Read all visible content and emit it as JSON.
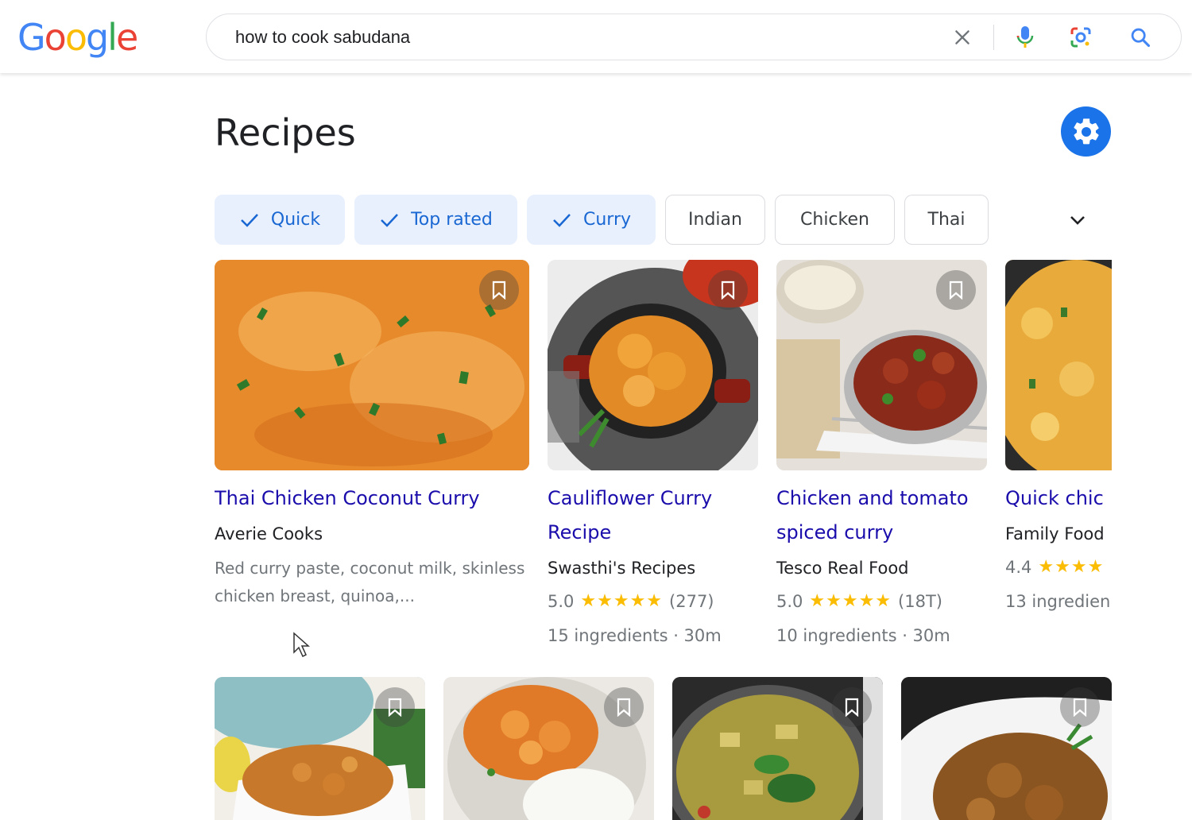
{
  "logo": {
    "letters": [
      "G",
      "o",
      "o",
      "g",
      "l",
      "e"
    ],
    "colors": [
      "#4285F4",
      "#EA4335",
      "#FBBC05",
      "#4285F4",
      "#34A853",
      "#EA4335"
    ]
  },
  "search": {
    "query": "how to cook sabudana"
  },
  "icons": {
    "clear": "close-icon",
    "voice": "mic-icon",
    "lens": "google-lens-icon",
    "search": "search-icon",
    "settings": "gear-icon",
    "bookmark": "bookmark-icon",
    "expand": "chevron-down-icon",
    "check": "check-icon"
  },
  "section": {
    "title": "Recipes"
  },
  "chips": [
    {
      "label": "Quick",
      "selected": true
    },
    {
      "label": "Top rated",
      "selected": true
    },
    {
      "label": "Curry",
      "selected": true
    },
    {
      "label": "Indian",
      "selected": false
    },
    {
      "label": "Chicken",
      "selected": false
    },
    {
      "label": "Thai",
      "selected": false
    }
  ],
  "recipes": [
    {
      "title": "Thai Chicken Coconut Curry",
      "source": "Averie Cooks",
      "description": "Red curry paste, coconut milk, skinless chicken breast, quinoa,..."
    },
    {
      "title_line1": "Cauliflower Curry",
      "title_line2": "Recipe",
      "source": "Swasthi's Recipes",
      "rating": "5.0",
      "stars": "★★★★★",
      "reviews": "(277)",
      "meta": "15 ingredients · 30m"
    },
    {
      "title_line1": "Chicken and tomato",
      "title_line2": "spiced curry",
      "source": "Tesco Real Food",
      "rating": "5.0",
      "stars": "★★★★★",
      "reviews": "(18T)",
      "meta": "10 ingredients · 30m"
    },
    {
      "title": "Quick chic",
      "source": "Family Food",
      "rating": "4.4",
      "stars": "★★★★",
      "meta": "13 ingredien"
    }
  ],
  "colors": {
    "link": "#1a0dab",
    "accent": "#1a73e8",
    "chip_selected_bg": "#e8f0fe",
    "chip_selected_text": "#1967d2",
    "star": "#fbbc04"
  }
}
